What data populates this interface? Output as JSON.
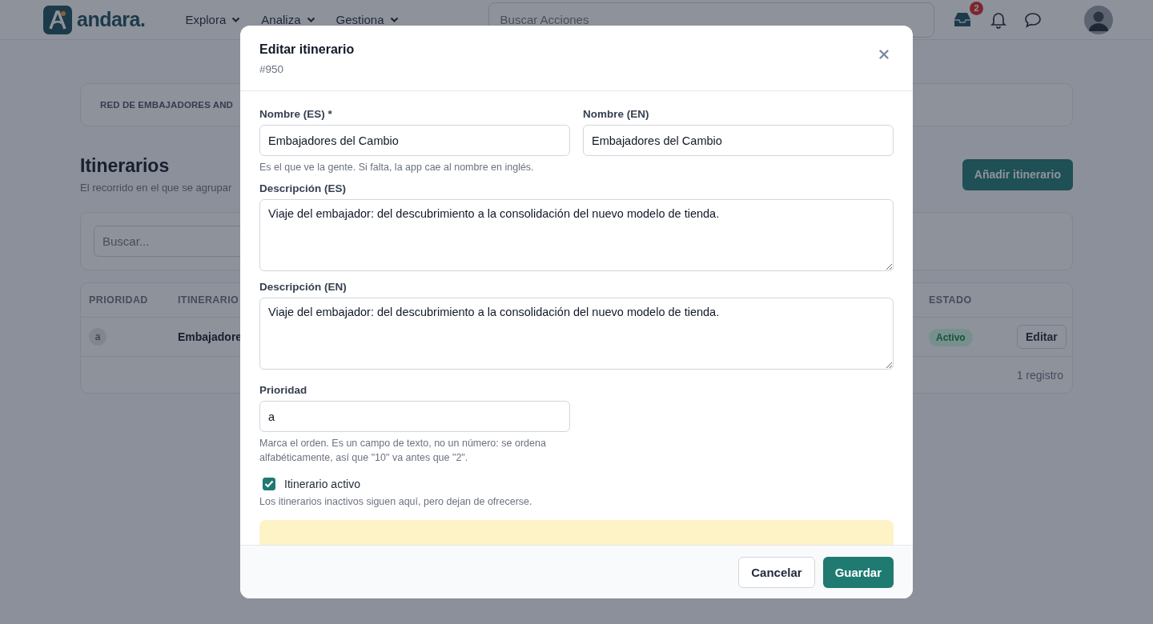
{
  "header": {
    "logo": "andara.",
    "nav": [
      {
        "label": "Explora"
      },
      {
        "label": "Analiza"
      },
      {
        "label": "Gestiona"
      }
    ],
    "search": {
      "placeholder": "Buscar Acciones"
    },
    "inbox_badge": "2"
  },
  "breadcrumb": "RED DE EMBAJADORES AND",
  "page": {
    "title": "Itinerarios",
    "subtitle": "El recorrido en el que se agrupar",
    "add_button": "Añadir itinerario"
  },
  "filter": {
    "placeholder": "Buscar..."
  },
  "table": {
    "columns": [
      "PRIORIDAD",
      "ITINERARIO",
      "ESTADO"
    ],
    "rows": [
      {
        "priority": "a",
        "itinerary": "Embajadore",
        "status": "Activo",
        "active": true,
        "action": "Editar"
      }
    ],
    "footer": "1 registro"
  },
  "modal": {
    "title": "Editar itinerario",
    "subtitle": "#950",
    "fields": [
      {
        "kind": "input",
        "label": "Nombre (ES) *",
        "value": "Embajadores del Cambio",
        "hint": "Es el que ve la gente. Si falta, la app cae al nombre en inglés."
      },
      {
        "kind": "input",
        "label": "Nombre (EN)",
        "value": "Embajadores del Cambio"
      },
      {
        "kind": "textarea",
        "label": "Descripción (ES)",
        "value": "Viaje del embajador: del descubrimiento a la consolidación del nuevo modelo de tienda."
      },
      {
        "kind": "textarea",
        "label": "Descripción (EN)",
        "value": "Viaje del embajador: del descubrimiento a la consolidación del nuevo modelo de tienda."
      },
      {
        "kind": "input",
        "label": "Prioridad",
        "value": "a",
        "hint": "Marca el orden. Es un campo de texto, no un número: se ordena alfabéticamente, así que \"10\" va antes que \"2\"."
      },
      {
        "kind": "checkbox",
        "label": "Itinerario activo",
        "checked": true,
        "hint": "Los itinerarios inactivos siguen aquí, pero dejan de ofrecerse."
      }
    ],
    "buttons": [
      {
        "label": "Cancelar",
        "kind": "secondary"
      },
      {
        "label": "Guardar",
        "kind": "primary"
      }
    ]
  }
}
